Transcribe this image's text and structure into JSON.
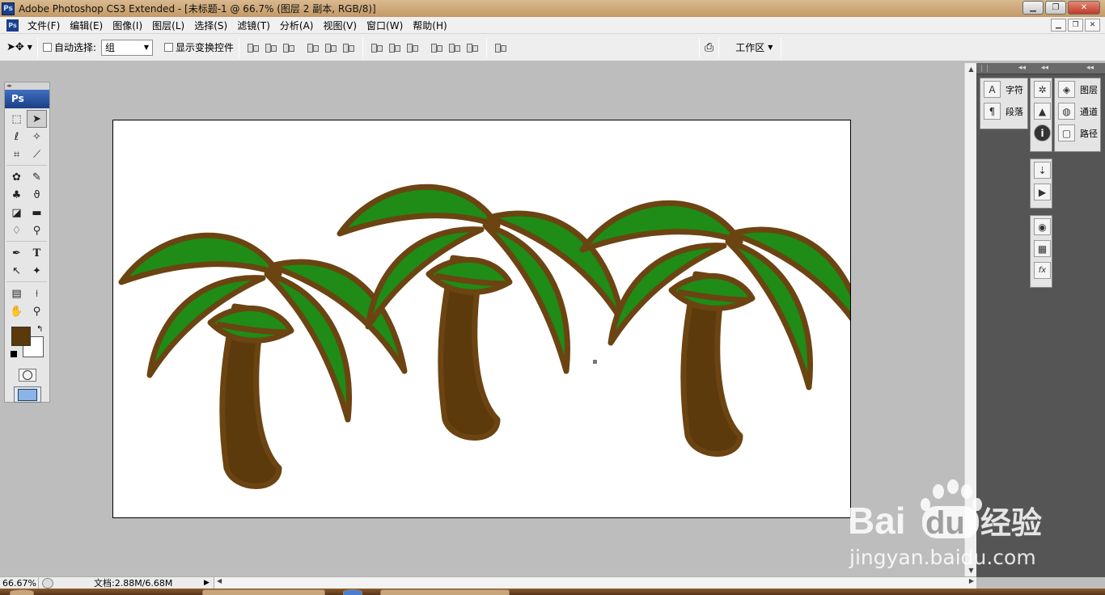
{
  "window": {
    "title": "Adobe Photoshop CS3 Extended - [未标题-1 @ 66.7% (图层 2 副本, RGB/8)]",
    "app_logo": "Ps",
    "controls": [
      "minimize-icon",
      "restore-icon",
      "close-icon"
    ]
  },
  "menu": {
    "items": [
      "文件(F)",
      "编辑(E)",
      "图像(I)",
      "图层(L)",
      "选择(S)",
      "滤镜(T)",
      "分析(A)",
      "视图(V)",
      "窗口(W)",
      "帮助(H)"
    ]
  },
  "options": {
    "auto_select_label": "自动选择:",
    "auto_select_value": "组",
    "show_transform_label": "显示变换控件",
    "workspace_label": "工作区"
  },
  "toolbox": {
    "header": "Ps",
    "foreground_color": "#5a3a0a",
    "background_color": "#ffffff"
  },
  "panels": {
    "group1": [
      {
        "icon": "character-icon",
        "glyph": "A",
        "label": "字符"
      },
      {
        "icon": "paragraph-icon",
        "glyph": "¶",
        "label": "段落"
      }
    ],
    "group2": [
      {
        "icon": "navigator-icon",
        "glyph": "✲"
      },
      {
        "icon": "histogram-icon",
        "glyph": "▲"
      },
      {
        "icon": "info-icon",
        "glyph": "i"
      }
    ],
    "group3": [
      {
        "icon": "history-icon",
        "glyph": "⇣"
      },
      {
        "icon": "actions-icon",
        "glyph": "▶"
      }
    ],
    "group4": [
      {
        "icon": "color-icon",
        "glyph": "◉"
      },
      {
        "icon": "swatches-icon",
        "glyph": "▦"
      },
      {
        "icon": "styles-icon",
        "glyph": "fx"
      }
    ],
    "group5": [
      {
        "icon": "layers-icon",
        "glyph": "◈",
        "label": "图层"
      },
      {
        "icon": "channels-icon",
        "glyph": "◍",
        "label": "通道"
      },
      {
        "icon": "paths-icon",
        "glyph": "▢",
        "label": "路径"
      }
    ]
  },
  "status": {
    "zoom": "66.67%",
    "doc_info": "文档:2.88M/6.68M"
  },
  "watermark": {
    "brand": "Bai",
    "brand2": "du",
    "product": "经验",
    "url": "jingyan.baidu.com"
  },
  "colors": {
    "leaf_green": "#1e8c16",
    "trunk_brown": "#5c3a0c",
    "outline_brown": "#6b4412"
  }
}
